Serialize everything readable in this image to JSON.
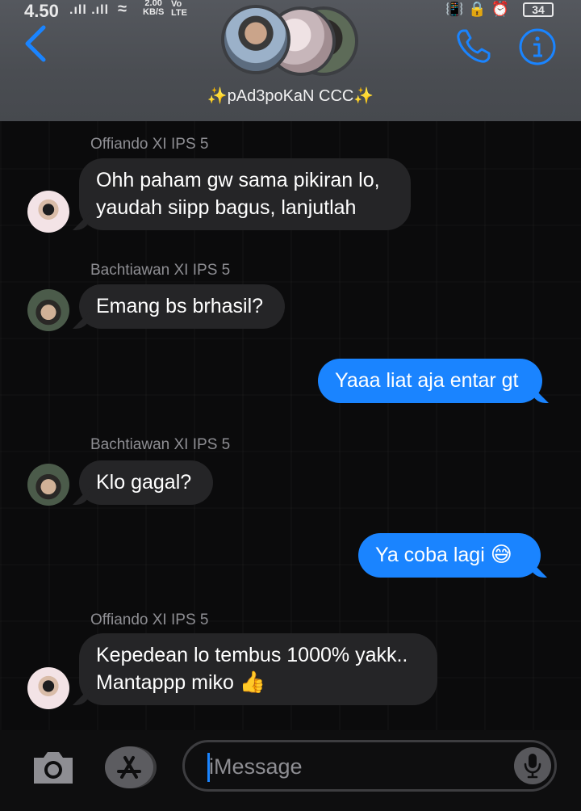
{
  "status_bar": {
    "time": "4.50",
    "signal": ".ıll .ıll",
    "wifi": "≈",
    "speed": "2.00\nKB/S",
    "network": "Vo\nLTE",
    "icons": "📳🔒⏰",
    "battery": "34"
  },
  "header": {
    "group_name": "✨pAd3poKaN CCC✨",
    "icons": [
      "back-chevron-icon",
      "phone-icon",
      "info-icon"
    ],
    "accent_color": "#1a84ff"
  },
  "messages": [
    {
      "sender": "Offiando XI IPS 5",
      "direction": "in",
      "lines": [
        "Ohh paham gw sama pikiran lo,",
        "yaudah siipp bagus, lanjutlah"
      ]
    },
    {
      "sender": "Bachtiawan XI IPS 5",
      "direction": "in",
      "lines": [
        "Emang bs brhasil?"
      ]
    },
    {
      "sender": "",
      "direction": "out",
      "lines": [
        "Yaaa liat aja entar gt"
      ]
    },
    {
      "sender": "Bachtiawan XI IPS 5",
      "direction": "in",
      "lines": [
        "Klo gagal?"
      ]
    },
    {
      "sender": "",
      "direction": "out",
      "lines": [
        "Ya coba lagi",
        "😅"
      ]
    },
    {
      "sender": "Offiando XI IPS 5",
      "direction": "in",
      "lines": [
        "Kepedean lo tembus 1000% yakk..",
        "Mantappp miko",
        "👍"
      ]
    }
  ],
  "composer": {
    "placeholder": "iMessage",
    "icons": [
      "camera-icon",
      "app-store-icon",
      "microphone-icon"
    ]
  }
}
